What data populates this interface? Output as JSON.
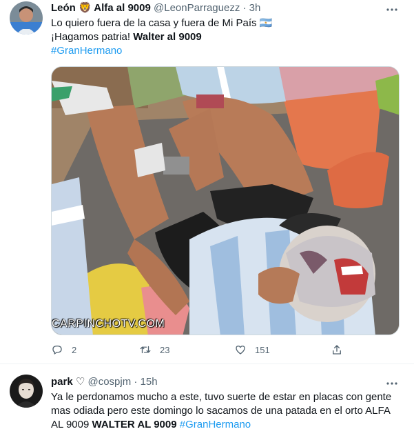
{
  "tweets": [
    {
      "author_name": "León 🦁 Alfa al 9009",
      "handle": "@LeonParraguezz",
      "separator": "·",
      "time": "3h",
      "lines": [
        "Lo quiero fuera de la casa y fuera de Mi País 🇦🇷",
        "¡Hagamos patria! ",
        "#GranHermano"
      ],
      "bold_fragment": "Walter al 9009",
      "media_watermark": "CARPINCHOTV.COM",
      "actions": {
        "replies": "2",
        "retweets": "23",
        "likes": "151"
      }
    },
    {
      "author_name": "park ♡",
      "handle": "@cospjm",
      "separator": "·",
      "time": "15h",
      "lines": [
        "Ya le perdonamos mucho a este, tuvo suerte de estar en placas con gente",
        "mas odiada pero este domingo lo sacamos de una patada en el orto ALFA",
        "AL 9009 "
      ],
      "bold_fragment": "WALTER AL 9009",
      "hashtag": "#GranHermano"
    }
  ],
  "colors": {
    "text": "#0f1419",
    "secondary": "#536471",
    "link": "#1d9bf0",
    "border": "#eff3f4"
  },
  "icons": [
    "more-icon",
    "reply-icon",
    "retweet-icon",
    "like-icon",
    "share-icon"
  ]
}
